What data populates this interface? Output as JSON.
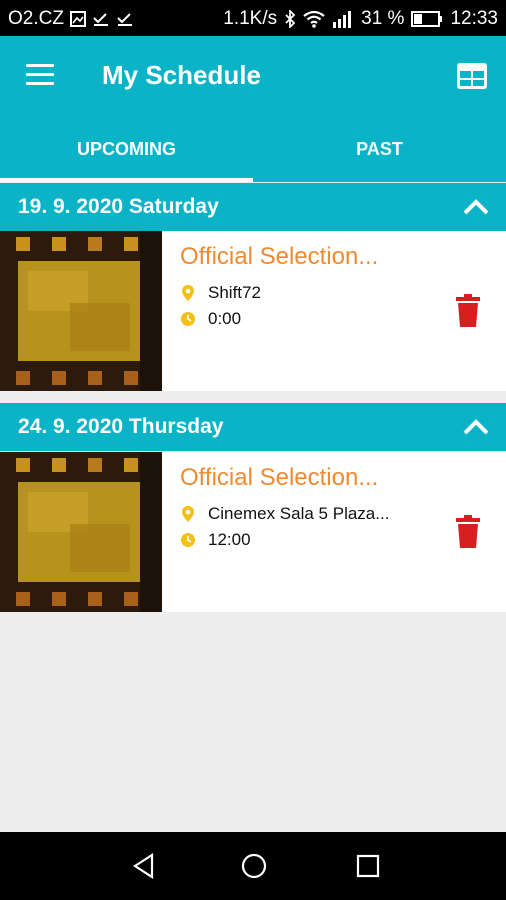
{
  "status": {
    "carrier": "O2.CZ",
    "speed": "1.1K/s",
    "battery": "31 %",
    "time": "12:33"
  },
  "app_bar": {
    "title": "My Schedule",
    "menu_icon": "hamburger-menu-icon",
    "calendar_icon": "calendar-grid-icon"
  },
  "tabs": [
    {
      "label": "UPCOMING",
      "active": true
    },
    {
      "label": "PAST",
      "active": false
    }
  ],
  "sections": [
    {
      "date": "19. 9. 2020 Saturday",
      "events": [
        {
          "title": "Official Selection...",
          "location": "Shift72",
          "time": "0:00"
        }
      ]
    },
    {
      "date": "24. 9. 2020 Thursday",
      "events": [
        {
          "title": "Official Selection...",
          "location": "Cinemex Sala 5 Plaza...",
          "time": "12:00"
        }
      ]
    }
  ],
  "colors": {
    "primary": "#0bb3c6",
    "title_orange": "#f08a30",
    "icon_yellow": "#f2c019",
    "trash_red": "#d81f1f",
    "background": "#ededed"
  }
}
